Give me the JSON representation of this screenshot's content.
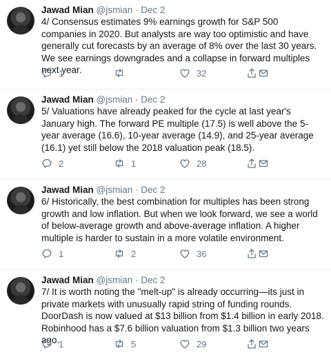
{
  "tweets": [
    {
      "author": "Jawad Mian",
      "handle": "@jsmian",
      "sep": "·",
      "date": "Dec 2",
      "text": "4/ Consensus estimates 9% earnings growth for S&P 500 companies in 2020. But analysts are way too optimistic and have generally cut forecasts by an average of 8% over the last 30 years. We see earnings downgrades and a collapse in forward multiples next year.",
      "replies": "1",
      "retweets": "",
      "likes": "32"
    },
    {
      "author": "Jawad Mian",
      "handle": "@jsmian",
      "sep": "·",
      "date": "Dec 2",
      "text": "5/ Valuations have already peaked for the cycle at last year's January high. The forward PE multiple (17.5) is well above the 5-year average (16.6), 10-year average (14.9), and 25-year average (16.1) yet still below the 2018 valuation peak (18.5).",
      "replies": "2",
      "retweets": "1",
      "likes": "28"
    },
    {
      "author": "Jawad Mian",
      "handle": "@jsmian",
      "sep": "·",
      "date": "Dec 2",
      "text": "6/ Historically, the best combination for multiples has been strong growth and low inflation. But when we look forward, we see a world of below-average growth and above-average inflation. A higher multiple is harder to sustain in a more volatile environment.",
      "replies": "1",
      "retweets": "2",
      "likes": "36"
    },
    {
      "author": "Jawad Mian",
      "handle": "@jsmian",
      "sep": "·",
      "date": "Dec 2",
      "text": "7/ It is worth noting the \"melt-up\" is already occurring—its just in private markets with unusually rapid string of funding rounds. DoorDash is now valued at $13 billion from $1.4 billion in early 2018. Robinhood has a $7.6 billion valuation from $1.3 billion two years ago.",
      "replies": "1",
      "retweets": "5",
      "likes": "29"
    }
  ],
  "colors": {
    "text": "#14171a",
    "muted": "#657786",
    "divider": "#e6ecf0",
    "background": "#ffffff"
  },
  "icons": [
    "reply-icon",
    "retweet-icon",
    "like-icon",
    "share-icon",
    "mail-icon"
  ]
}
